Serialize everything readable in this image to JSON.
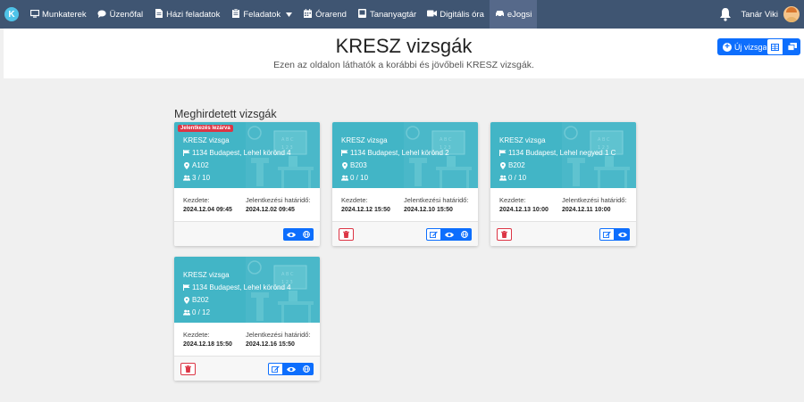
{
  "nav": {
    "items": [
      {
        "label": "Munkaterek",
        "icon": "monitor-icon"
      },
      {
        "label": "Üzenőfal",
        "icon": "chat-icon"
      },
      {
        "label": "Házi feladatok",
        "icon": "document-icon"
      },
      {
        "label": "Feladatok",
        "icon": "clipboard-icon"
      },
      {
        "label": "Órarend",
        "icon": "calendar-icon"
      },
      {
        "label": "Tananyagtár",
        "icon": "book-icon"
      },
      {
        "label": "Digitális óra",
        "icon": "video-icon"
      },
      {
        "label": "eJogsi",
        "icon": "car-icon"
      }
    ],
    "user_name": "Tanár Viki"
  },
  "header": {
    "title": "KRESZ vizsgák",
    "subtitle": "Ezen az oldalon láthatók a korábbi és jövőbeli KRESZ vizsgák.",
    "new_button": "Új vizsga"
  },
  "section_title": "Meghirdetett vizsgák",
  "labels": {
    "start": "Kezdete:",
    "deadline": "Jelentkezési határidő:"
  },
  "exams": [
    {
      "badge": "Jelentkezés lezárva",
      "title": "KRESZ vizsga",
      "address": "1134 Budapest, Lehel körönd 4",
      "room": "A102",
      "participants": "3 / 10",
      "start": "2024.12.04 09:45",
      "deadline": "2024.12.02 09:45"
    },
    {
      "title": "KRESZ vizsga",
      "address": "1134 Budapest, Lehel körönd 2",
      "room": "B203",
      "participants": "0 / 10",
      "start": "2024.12.12 15:50",
      "deadline": "2024.12.10 15:50"
    },
    {
      "title": "KRESZ vizsga",
      "address": "1134 Budapest, Lehel negyed 1 C",
      "room": "B202",
      "participants": "0 / 10",
      "start": "2024.12.13 10:00",
      "deadline": "2024.12.11 10:00"
    },
    {
      "title": "KRESZ vizsga",
      "address": "1134 Budapest, Lehel körönd 4",
      "room": "B202",
      "participants": "0 / 12",
      "start": "2024.12.18 15:50",
      "deadline": "2024.12.16 15:50"
    }
  ],
  "colors": {
    "navbar": "#3f5572",
    "card_header": "#42b5c6",
    "primary": "#0d6efd",
    "danger": "#dc3545"
  }
}
